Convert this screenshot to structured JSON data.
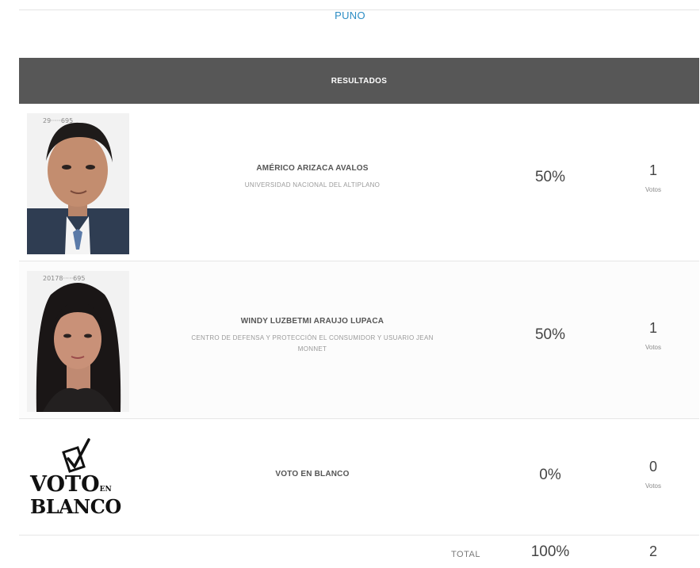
{
  "header": {
    "region": "PUNO",
    "results_title": "RESULTADOS"
  },
  "candidates": [
    {
      "name": "AMÉRICO ARIZACA AVALOS",
      "organization": "UNIVERSIDAD NACIONAL DEL ALTIPLANO",
      "percent": "50%",
      "votes": "1",
      "votes_label": "Votos"
    },
    {
      "name": "WINDY LUZBETMI ARAUJO LUPACA",
      "organization": "CENTRO DE DEFENSA Y PROTECCIÓN EL CONSUMIDOR Y USUARIO JEAN MONNET",
      "percent": "50%",
      "votes": "1",
      "votes_label": "Votos"
    },
    {
      "name": "VOTO EN BLANCO",
      "logo_text_1": "VOTO",
      "logo_text_small": "EN",
      "logo_text_2": "BLANCO",
      "percent": "0%",
      "votes": "0",
      "votes_label": "Votos"
    }
  ],
  "total": {
    "label": "TOTAL",
    "percent": "100%",
    "votes": "2"
  },
  "colors": {
    "header_bg": "#575757",
    "region_text": "#2b8cc4"
  },
  "icons": [
    "candidate-photo",
    "checkbox-vote-icon"
  ]
}
